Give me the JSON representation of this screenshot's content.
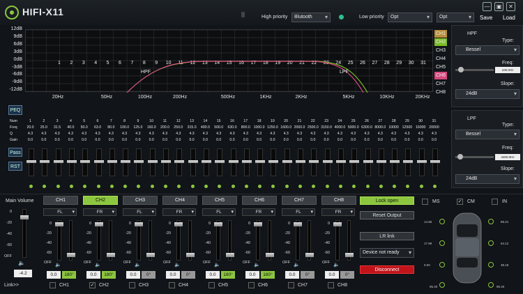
{
  "app": {
    "title": "HIFI-X11"
  },
  "header": {
    "high_priority_label": "High priority",
    "high_priority_value": "Blutooth",
    "low_priority_label": "Low priority",
    "low_priority_value": "Opt",
    "source_value": "Opt",
    "save_label": "Save",
    "load_label": "Load"
  },
  "graph": {
    "db_ticks": [
      "12dB",
      "9dB",
      "6dB",
      "3dB",
      "0dB",
      "-3dB",
      "-6dB",
      "-9dB",
      "-12dB"
    ],
    "freq_ticks": [
      "20Hz",
      "50Hz",
      "100Hz",
      "200Hz",
      "500Hz",
      "1KHz",
      "2KHz",
      "5KHz",
      "10KHz",
      "20KHz"
    ],
    "band_numbers": [
      "1",
      "2",
      "3",
      "4",
      "5",
      "6",
      "7",
      "8",
      "9",
      "10",
      "11",
      "12",
      "13",
      "14",
      "15",
      "16",
      "17",
      "18",
      "19",
      "20",
      "21",
      "22",
      "23",
      "24",
      "25",
      "26",
      "27",
      "28",
      "29",
      "30",
      "31"
    ],
    "hpf_label": "HPF",
    "lpf_label": "LPF",
    "channels": [
      "CH1",
      "CH2",
      "CH3",
      "CH4",
      "CH5",
      "CH6",
      "CH7",
      "CH8"
    ],
    "ch_colors": {
      "CH1": "#b98d3a",
      "CH2": "#7dbb28",
      "CH6": "#d6477e"
    }
  },
  "hpf": {
    "title": "HPF",
    "type_label": "Type:",
    "type_value": "Bessel",
    "freq_label": "Freq:",
    "freq_value": "100.0Hz",
    "slope_label": "Slope:",
    "slope_value": "24dB"
  },
  "lpf": {
    "title": "LPF",
    "type_label": "Type:",
    "type_value": "Bessel",
    "freq_label": "Freq:",
    "freq_value": "4450.0Hz",
    "slope_label": "Slope:",
    "slope_value": "24dB"
  },
  "eq": {
    "peq_label": "PEQ",
    "pass_label": "Pass",
    "rst_label": "RST",
    "row_labels": [
      "Num",
      "Freq",
      "Q",
      "Gain"
    ],
    "freqs": [
      "20.0",
      "25.0",
      "31.5",
      "40.0",
      "50.0",
      "63.0",
      "80.0",
      "100.0",
      "125.0",
      "160.0",
      "200.0",
      "250.0",
      "315.0",
      "400.0",
      "500.0",
      "630.0",
      "800.0",
      "1000.0",
      "1250.0",
      "1600.0",
      "2000.0",
      "2500.0",
      "3150.0",
      "4000.0",
      "5000.0",
      "6300.0",
      "8000.0",
      "10000",
      "12500",
      "16000",
      "20000"
    ],
    "q_value": "4.3",
    "gain_value": "0.0"
  },
  "main_volume": {
    "label": "Main Volume",
    "ticks": [
      "0",
      "-20",
      "-40",
      "-60",
      "OFF"
    ],
    "value": "-4.2"
  },
  "channels": [
    {
      "name": "CH1",
      "pos": "FL",
      "delay": "0.0",
      "phase": "180°",
      "phase_on": true,
      "ticks": [
        "0",
        "-20",
        "-40",
        "-60",
        "OFF"
      ]
    },
    {
      "name": "CH2",
      "pos": "FR",
      "delay": "0.0",
      "phase": "180°",
      "phase_on": true,
      "ticks": [
        "0",
        "-20",
        "-40",
        "-60",
        "OFF"
      ]
    },
    {
      "name": "CH3",
      "pos": "FL",
      "delay": "0.0",
      "phase": "0°",
      "phase_on": false,
      "ticks": [
        "0",
        "-20",
        "-40",
        "-60",
        "OFF"
      ]
    },
    {
      "name": "CH4",
      "pos": "FR",
      "delay": "0.0",
      "phase": "0°",
      "phase_on": false,
      "ticks": [
        "0",
        "-20",
        "-40",
        "-60",
        "OFF"
      ]
    },
    {
      "name": "CH5",
      "pos": "FL",
      "delay": "0.0",
      "phase": "180°",
      "phase_on": true,
      "ticks": [
        "0",
        "-20",
        "-40",
        "-60",
        "OFF"
      ]
    },
    {
      "name": "CH6",
      "pos": "FR",
      "delay": "0.0",
      "phase": "180°",
      "phase_on": true,
      "ticks": [
        "0",
        "-20",
        "-40",
        "-60",
        "OFF"
      ]
    },
    {
      "name": "CH7",
      "pos": "FL",
      "delay": "0.0",
      "phase": "0°",
      "phase_on": false,
      "ticks": [
        "0",
        "-20",
        "-40",
        "-60",
        "OFF"
      ]
    },
    {
      "name": "CH8",
      "pos": "FR",
      "delay": "0.0",
      "phase": "0°",
      "phase_on": false,
      "ticks": [
        "0",
        "-20",
        "-40",
        "-60",
        "OFF"
      ]
    }
  ],
  "link": {
    "label": "Link>>",
    "channels": [
      "CH1",
      "CH2",
      "CH3",
      "CH4",
      "CH5",
      "CH6",
      "CH7",
      "CH8"
    ],
    "checked": [
      false,
      true,
      false,
      false,
      false,
      false,
      false,
      false
    ]
  },
  "controls": {
    "lock_label": "Lock open",
    "reset_label": "Reset Output",
    "lr_link_label": "LR link",
    "device_value": "Device not ready",
    "disconnect_label": "Disconnect",
    "ms_label": "MS",
    "cm_label": "CM",
    "in_label": "IN"
  },
  "car": {
    "left_values": [
      "14.86",
      "17.99",
      "0.00"
    ],
    "right_values": [
      "89.21",
      "64.12",
      "38.18"
    ],
    "bottom_values": [
      "95.40",
      "95.40"
    ]
  }
}
